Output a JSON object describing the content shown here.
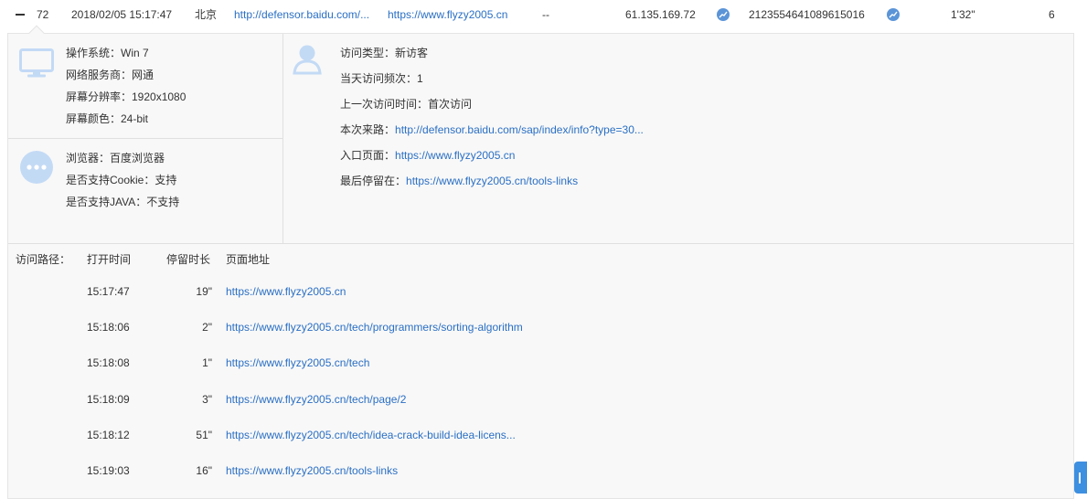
{
  "row": {
    "index": "72",
    "time": "2018/02/05 15:17:47",
    "region": "北京",
    "source": "http://defensor.baidu.com/...",
    "entry": "https://www.flyzy2005.cn",
    "keyword": "--",
    "ip": "61.135.169.72",
    "visitor_id": "2123554641089615016",
    "duration": "1'32\"",
    "pages": "6"
  },
  "device": {
    "os": "操作系统：Win 7",
    "isp": "网络服务商：网通",
    "resolution": "屏幕分辨率：1920x1080",
    "color": "屏幕颜色：24-bit"
  },
  "browser": {
    "name": "浏览器：百度浏览器",
    "cookie": "是否支持Cookie：支持",
    "java": "是否支持JAVA：不支持"
  },
  "visit": {
    "type_label": "访问类型：",
    "type_value": "新访客",
    "freq": "当天访问频次：1",
    "last_label": "上一次访问时间：",
    "last_value": "首次访问",
    "source_label": "本次来路：",
    "source_value": "http://defensor.baidu.com/sap/index/info?type=30...",
    "entry_label": "入口页面：",
    "entry_value": "https://www.flyzy2005.cn",
    "exit_label": "最后停留在：",
    "exit_value": "https://www.flyzy2005.cn/tools-links"
  },
  "path": {
    "label": "访问路径：",
    "headers": {
      "open_time": "打开时间",
      "stay": "停留时长",
      "url": "页面地址"
    },
    "rows": [
      {
        "time": "15:17:47",
        "stay": "19\"",
        "url": "https://www.flyzy2005.cn"
      },
      {
        "time": "15:18:06",
        "stay": "2\"",
        "url": "https://www.flyzy2005.cn/tech/programmers/sorting-algorithm"
      },
      {
        "time": "15:18:08",
        "stay": "1\"",
        "url": "https://www.flyzy2005.cn/tech"
      },
      {
        "time": "15:18:09",
        "stay": "3\"",
        "url": "https://www.flyzy2005.cn/tech/page/2"
      },
      {
        "time": "15:18:12",
        "stay": "51\"",
        "url": "https://www.flyzy2005.cn/tech/idea-crack-build-idea-licens..."
      },
      {
        "time": "15:19:03",
        "stay": "16\"",
        "url": "https://www.flyzy2005.cn/tools-links"
      }
    ]
  },
  "colors": {
    "link": "#2a6fc4",
    "icon": "#c3daf5",
    "trend": "#5b95d8",
    "panel": "#f8f8f8"
  }
}
